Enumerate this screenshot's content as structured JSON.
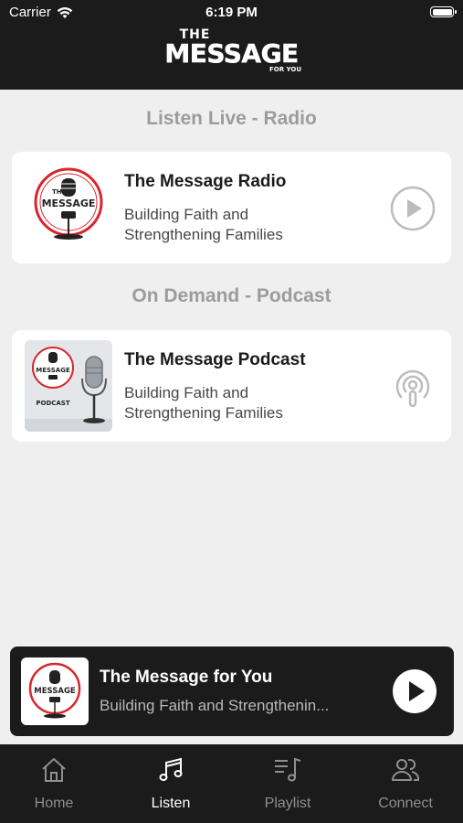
{
  "status_bar": {
    "carrier": "Carrier",
    "time": "6:19 PM"
  },
  "header": {
    "logo_line1": "THE",
    "logo_line2": "MESSAGE",
    "logo_line3": "FOR YOU"
  },
  "sections": [
    {
      "title": "Listen Live - Radio",
      "item": {
        "title": "The Message Radio",
        "description": "Building Faith and Strengthening Families",
        "art_icon": "radio-mic-logo-icon",
        "action_icon": "play-circle-icon"
      }
    },
    {
      "title": "On Demand - Podcast",
      "item": {
        "title": "The Message Podcast",
        "description": "Building Faith and Strengthening Families",
        "art_icon": "podcast-mic-logo-icon",
        "art_caption": "PODCAST",
        "action_icon": "podcast-icon"
      }
    }
  ],
  "now_playing": {
    "title": "The Message for You",
    "description": "Building Faith and Strengthenin...",
    "action_icon": "play-icon"
  },
  "tabs": [
    {
      "label": "Home",
      "icon": "home-icon",
      "active": false
    },
    {
      "label": "Listen",
      "icon": "music-note-icon",
      "active": true
    },
    {
      "label": "Playlist",
      "icon": "playlist-icon",
      "active": false
    },
    {
      "label": "Connect",
      "icon": "people-icon",
      "active": false
    }
  ],
  "colors": {
    "header_bg": "#1b1b1b",
    "accent_red": "#d8262c",
    "page_bg": "#efefef"
  }
}
